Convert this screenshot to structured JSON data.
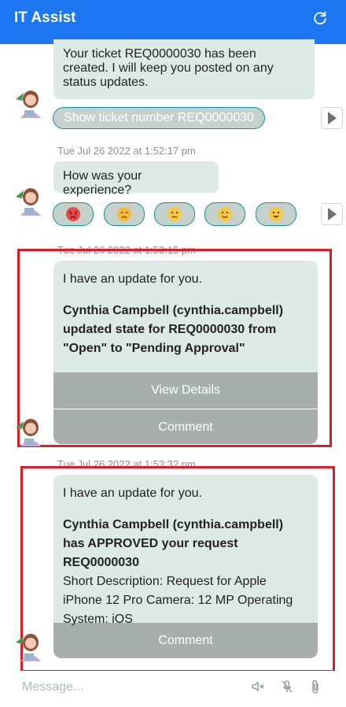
{
  "header": {
    "title": "IT Assist",
    "refresh_icon": "refresh-icon"
  },
  "messages": {
    "ticket_created": "Your ticket REQ0000030 has been created. I will keep you posted on any status updates.",
    "show_ticket_button": "Show ticket number REQ0000030",
    "timestamp_1": "Tue Jul 26 2022 at 1:52:17 pm",
    "experience_question": "How was your experience?",
    "rating_icons": [
      "very-angry-face-icon",
      "sad-face-icon",
      "neutral-face-icon",
      "slight-smile-face-icon",
      "happy-face-icon"
    ],
    "timestamp_2": "Tue Jul 26 2022 at 1:53:15 pm",
    "update1": {
      "intro": "I have an update for you.",
      "bold": "Cynthia Campbell (cynthia.campbell) updated state for REQ0000030 from \"Open\" to \"Pending Approval\"",
      "view_details": "View Details",
      "comment": "Comment"
    },
    "timestamp_3": "Tue Jul 26 2022 at 1:53:32 pm",
    "update2": {
      "intro": "I have an update for you.",
      "bold": "Cynthia Campbell (cynthia.campbell) has APPROVED your request REQ0000030",
      "detail": "Short Description: Request for Apple iPhone 12 Pro Camera: 12 MP Operating System: iOS",
      "comment": "Comment"
    }
  },
  "composer": {
    "placeholder": "Message...",
    "mute_icon": "speaker-mute-icon",
    "mic_icon": "mic-off-icon",
    "attach_icon": "paperclip-icon"
  },
  "colors": {
    "header": "#1c76f2",
    "bubble": "#dde9e4",
    "action": "#a8aeab",
    "highlight": "#e11b26"
  }
}
